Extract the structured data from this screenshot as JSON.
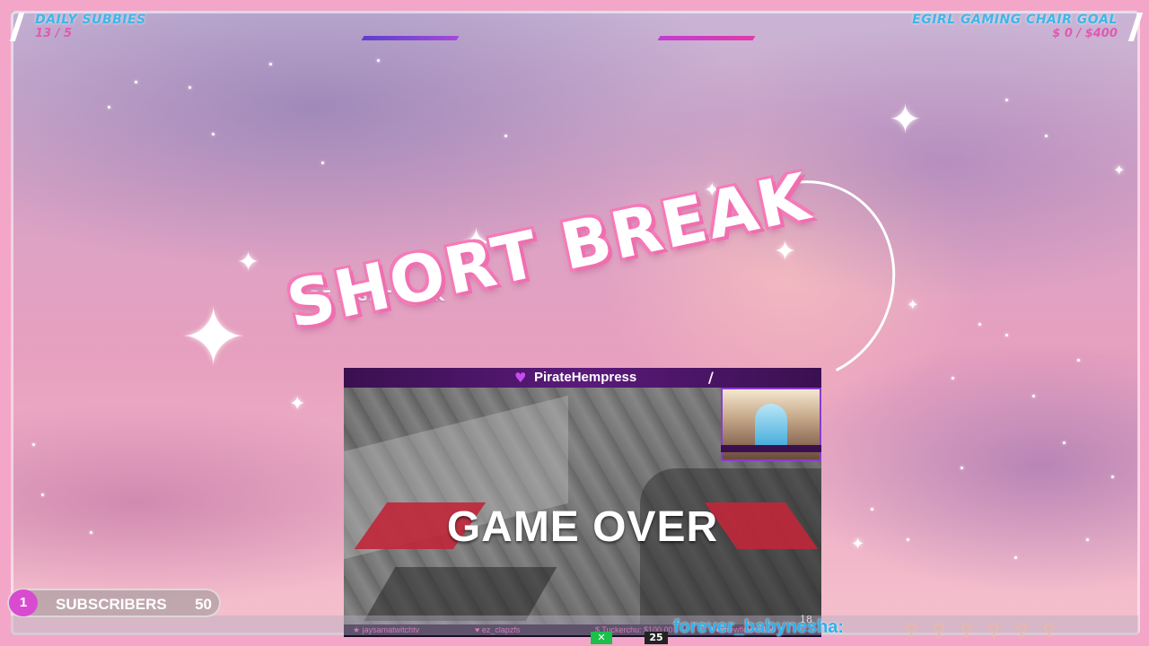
{
  "goals": {
    "daily_subs": {
      "title": "DAILY SUBBIES",
      "value": "13 / 5"
    },
    "chair_goal": {
      "title": "EGIRL GAMING CHAIR GOAL",
      "value": "$ 0 / $400"
    }
  },
  "scene": {
    "subtitle": "BE RiGHT BACK",
    "headline": "SHORT BREAK"
  },
  "embed": {
    "streamer": "PirateHempress",
    "slash": "/",
    "game_text": "GAME OVER",
    "page_number": "18",
    "footer": [
      {
        "icon": "star-icon",
        "text": "jaysamatwitchtv"
      },
      {
        "icon": "heart-icon",
        "text": "ez_clapzfs"
      },
      {
        "icon": "dollar-icon",
        "text": "Tuckerchu: $100.00"
      },
      {
        "icon": "diamond-icon",
        "text": "drewflows: 100"
      }
    ]
  },
  "subscribers": {
    "count": "1",
    "label": "SUBSCRIBERS",
    "goal": "50"
  },
  "ticker": {
    "name": "forever_babynesha:",
    "badge_x": "✕",
    "badge_n": "25"
  },
  "colors": {
    "accent_blue": "#3fb6e8",
    "accent_pink": "#e05ab0",
    "frame_pink": "#f3a6c8",
    "red": "#c0273a"
  }
}
